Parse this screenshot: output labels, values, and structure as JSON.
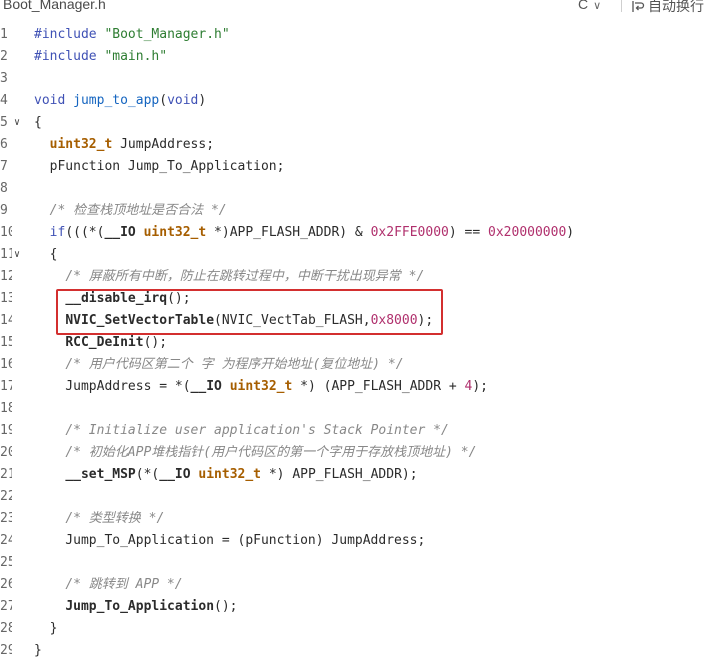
{
  "header": {
    "filename": "Boot_Manager.h",
    "language": "C",
    "wrap_label": "自动换行"
  },
  "lines": [
    {
      "n": "1",
      "fold": "",
      "tokens": [
        {
          "t": "#include ",
          "c": "kw"
        },
        {
          "t": "\"Boot_Manager.h\"",
          "c": "str"
        }
      ]
    },
    {
      "n": "2",
      "fold": "",
      "tokens": [
        {
          "t": "#include ",
          "c": "kw"
        },
        {
          "t": "\"main.h\"",
          "c": "str"
        }
      ]
    },
    {
      "n": "3",
      "fold": "",
      "tokens": []
    },
    {
      "n": "4",
      "fold": "",
      "tokens": [
        {
          "t": "void ",
          "c": "kw"
        },
        {
          "t": "jump_to_app",
          "c": "fn"
        },
        {
          "t": "(",
          "c": ""
        },
        {
          "t": "void",
          "c": "kw"
        },
        {
          "t": ")",
          "c": ""
        }
      ]
    },
    {
      "n": "5",
      "fold": "v",
      "tokens": [
        {
          "t": "{",
          "c": ""
        }
      ]
    },
    {
      "n": "6",
      "fold": "",
      "tokens": [
        {
          "t": "  ",
          "c": ""
        },
        {
          "t": "uint32_t",
          "c": "type"
        },
        {
          "t": " JumpAddress;",
          "c": ""
        }
      ]
    },
    {
      "n": "7",
      "fold": "",
      "tokens": [
        {
          "t": "  pFunction Jump_To_Application;",
          "c": ""
        }
      ]
    },
    {
      "n": "8",
      "fold": "",
      "tokens": []
    },
    {
      "n": "9",
      "fold": "",
      "tokens": [
        {
          "t": "  ",
          "c": ""
        },
        {
          "t": "/* 检查栈顶地址是否合法 */",
          "c": "cm"
        }
      ]
    },
    {
      "n": "10",
      "fold": "",
      "tokens": [
        {
          "t": "  ",
          "c": ""
        },
        {
          "t": "if",
          "c": "kw"
        },
        {
          "t": "(((*(",
          "c": ""
        },
        {
          "t": "__IO",
          "c": "b"
        },
        {
          "t": " ",
          "c": ""
        },
        {
          "t": "uint32_t",
          "c": "type"
        },
        {
          "t": " *)APP_FLASH_ADDR) & ",
          "c": ""
        },
        {
          "t": "0x2FFE0000",
          "c": "num"
        },
        {
          "t": ") == ",
          "c": ""
        },
        {
          "t": "0x20000000",
          "c": "num"
        },
        {
          "t": ")",
          "c": ""
        }
      ]
    },
    {
      "n": "11",
      "fold": "v",
      "tokens": [
        {
          "t": "  {",
          "c": ""
        }
      ]
    },
    {
      "n": "12",
      "fold": "",
      "tokens": [
        {
          "t": "    ",
          "c": ""
        },
        {
          "t": "/* 屏蔽所有中断，防止在跳转过程中，中断干扰出现异常 */",
          "c": "cm"
        }
      ]
    },
    {
      "n": "13",
      "fold": "",
      "tokens": [
        {
          "t": "    ",
          "c": ""
        },
        {
          "t": "__disable_irq",
          "c": "b"
        },
        {
          "t": "();",
          "c": ""
        }
      ]
    },
    {
      "n": "14",
      "fold": "",
      "tokens": [
        {
          "t": "    ",
          "c": ""
        },
        {
          "t": "NVIC_SetVectorTable",
          "c": "b"
        },
        {
          "t": "(NVIC_VectTab_FLASH,",
          "c": ""
        },
        {
          "t": "0x8000",
          "c": "num"
        },
        {
          "t": ");",
          "c": ""
        }
      ]
    },
    {
      "n": "15",
      "fold": "",
      "tokens": [
        {
          "t": "    ",
          "c": ""
        },
        {
          "t": "RCC_DeInit",
          "c": "b"
        },
        {
          "t": "();",
          "c": ""
        }
      ]
    },
    {
      "n": "16",
      "fold": "",
      "tokens": [
        {
          "t": "    ",
          "c": ""
        },
        {
          "t": "/* 用户代码区第二个 字 为程序开始地址(复位地址) */",
          "c": "cm"
        }
      ]
    },
    {
      "n": "17",
      "fold": "",
      "tokens": [
        {
          "t": "    JumpAddress = *(",
          "c": ""
        },
        {
          "t": "__IO",
          "c": "b"
        },
        {
          "t": " ",
          "c": ""
        },
        {
          "t": "uint32_t",
          "c": "type"
        },
        {
          "t": " *) (APP_FLASH_ADDR + ",
          "c": ""
        },
        {
          "t": "4",
          "c": "num"
        },
        {
          "t": ");",
          "c": ""
        }
      ]
    },
    {
      "n": "18",
      "fold": "",
      "tokens": []
    },
    {
      "n": "19",
      "fold": "",
      "tokens": [
        {
          "t": "    ",
          "c": ""
        },
        {
          "t": "/* Initialize user application's Stack Pointer */",
          "c": "cm"
        }
      ]
    },
    {
      "n": "20",
      "fold": "",
      "tokens": [
        {
          "t": "    ",
          "c": ""
        },
        {
          "t": "/* 初始化APP堆栈指针(用户代码区的第一个字用于存放栈顶地址) */",
          "c": "cm"
        }
      ]
    },
    {
      "n": "21",
      "fold": "",
      "tokens": [
        {
          "t": "    ",
          "c": ""
        },
        {
          "t": "__set_MSP",
          "c": "b"
        },
        {
          "t": "(*(",
          "c": ""
        },
        {
          "t": "__IO",
          "c": "b"
        },
        {
          "t": " ",
          "c": ""
        },
        {
          "t": "uint32_t",
          "c": "type"
        },
        {
          "t": " *) APP_FLASH_ADDR);",
          "c": ""
        }
      ]
    },
    {
      "n": "22",
      "fold": "",
      "tokens": []
    },
    {
      "n": "23",
      "fold": "",
      "tokens": [
        {
          "t": "    ",
          "c": ""
        },
        {
          "t": "/* 类型转换 */",
          "c": "cm"
        }
      ]
    },
    {
      "n": "24",
      "fold": "",
      "tokens": [
        {
          "t": "    Jump_To_Application = (pFunction) JumpAddress;",
          "c": ""
        }
      ]
    },
    {
      "n": "25",
      "fold": "",
      "tokens": []
    },
    {
      "n": "26",
      "fold": "",
      "tokens": [
        {
          "t": "    ",
          "c": ""
        },
        {
          "t": "/* 跳转到 APP */",
          "c": "cm"
        }
      ]
    },
    {
      "n": "27",
      "fold": "",
      "tokens": [
        {
          "t": "    ",
          "c": ""
        },
        {
          "t": "Jump_To_Application",
          "c": "b"
        },
        {
          "t": "();",
          "c": ""
        }
      ]
    },
    {
      "n": "28",
      "fold": "",
      "tokens": [
        {
          "t": "  }",
          "c": ""
        }
      ]
    },
    {
      "n": "29",
      "fold": "",
      "tokens": [
        {
          "t": "}",
          "c": ""
        }
      ]
    }
  ],
  "highlight": {
    "color": "#d32f2f",
    "lines": [
      "13",
      "14"
    ]
  }
}
